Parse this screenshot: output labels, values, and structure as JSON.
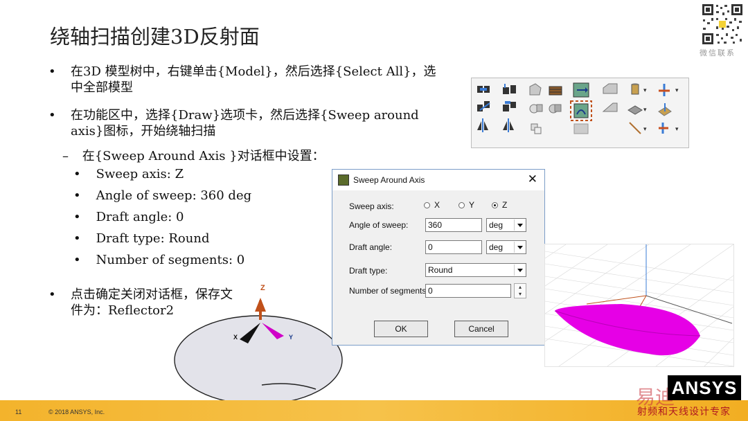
{
  "slide": {
    "title": "绕轴扫描创建3D反射面",
    "bullets": [
      {
        "line1": "在3D 模型树中，右键单击{Model}，然后选择{Select All}，选",
        "line2": "中全部模型"
      },
      {
        "line1": "在功能区中，选择{Draw}选项卡，然后选择{Sweep around",
        "line2": "axis}图标，开始绕轴扫描"
      }
    ],
    "dash_item": "在{Sweep Around Axis }对话框中设置：",
    "settings": [
      "Sweep axis: Z",
      "Angle of sweep: 360 deg",
      "Draft angle: 0",
      "Draft type: Round",
      "Number of segments: 0"
    ],
    "last_bullet": {
      "line1": "点击确定关闭对话框，保存文",
      "line2": "件为：Reflector2"
    },
    "bullet_glyph": "•",
    "dash_glyph": "–"
  },
  "qr_caption": "微信联系",
  "dialog": {
    "title": "Sweep Around Axis",
    "close_glyph": "✕",
    "sweep_axis_label": "Sweep axis:",
    "axes": [
      {
        "label": "X",
        "selected": false
      },
      {
        "label": "Y",
        "selected": false
      },
      {
        "label": "Z",
        "selected": true
      }
    ],
    "angle_label": "Angle of sweep:",
    "angle_value": "360",
    "angle_unit": "deg",
    "draft_angle_label": "Draft angle:",
    "draft_angle_value": "0",
    "draft_angle_unit": "deg",
    "draft_type_label": "Draft type:",
    "draft_type_value": "Round",
    "segments_label": "Number of segments:",
    "segments_value": "0",
    "ok_label": "OK",
    "cancel_label": "Cancel"
  },
  "axes_triad": {
    "z": "Z",
    "x": "X",
    "y": "Y"
  },
  "footer": {
    "page_number": "11",
    "copyright": "© 2018 ANSYS, Inc.",
    "brand": "ANSYS",
    "watermark": "易迪",
    "watermark_sub": "射频和天线设计专家"
  },
  "colors": {
    "footer_bar": "#f3b32c",
    "reflector": "#e600e6",
    "highlight_box": "#c0501a"
  }
}
